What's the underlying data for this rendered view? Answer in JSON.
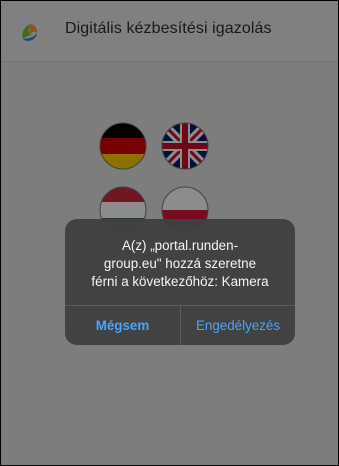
{
  "header": {
    "title": "Digitális kézbesítési igazolás",
    "logo_icon": "app-logo-icon"
  },
  "languages": [
    {
      "name": "german-flag-icon",
      "colors": [
        "#000000",
        "#dd0000",
        "#ffce00"
      ]
    },
    {
      "name": "uk-flag-icon",
      "colors": [
        "#012169",
        "#ffffff",
        "#c8102e"
      ]
    },
    {
      "name": "hungarian-flag-icon",
      "colors": [
        "#cd2a3e",
        "#ffffff",
        "#436f4d"
      ]
    },
    {
      "name": "polish-flag-icon",
      "colors": [
        "#ffffff",
        "#dc143c"
      ]
    }
  ],
  "dialog": {
    "message": "A(z) „portal.runden-\ngroup.eu\" hozzá szeretne\nférni a következőhöz: Kamera",
    "cancel_label": "Mégsem",
    "allow_label": "Engedélyezés"
  },
  "colors": {
    "accent": "#4aa3ff",
    "alert_bg": "#404040",
    "header_bg": "#e9e9e9"
  }
}
